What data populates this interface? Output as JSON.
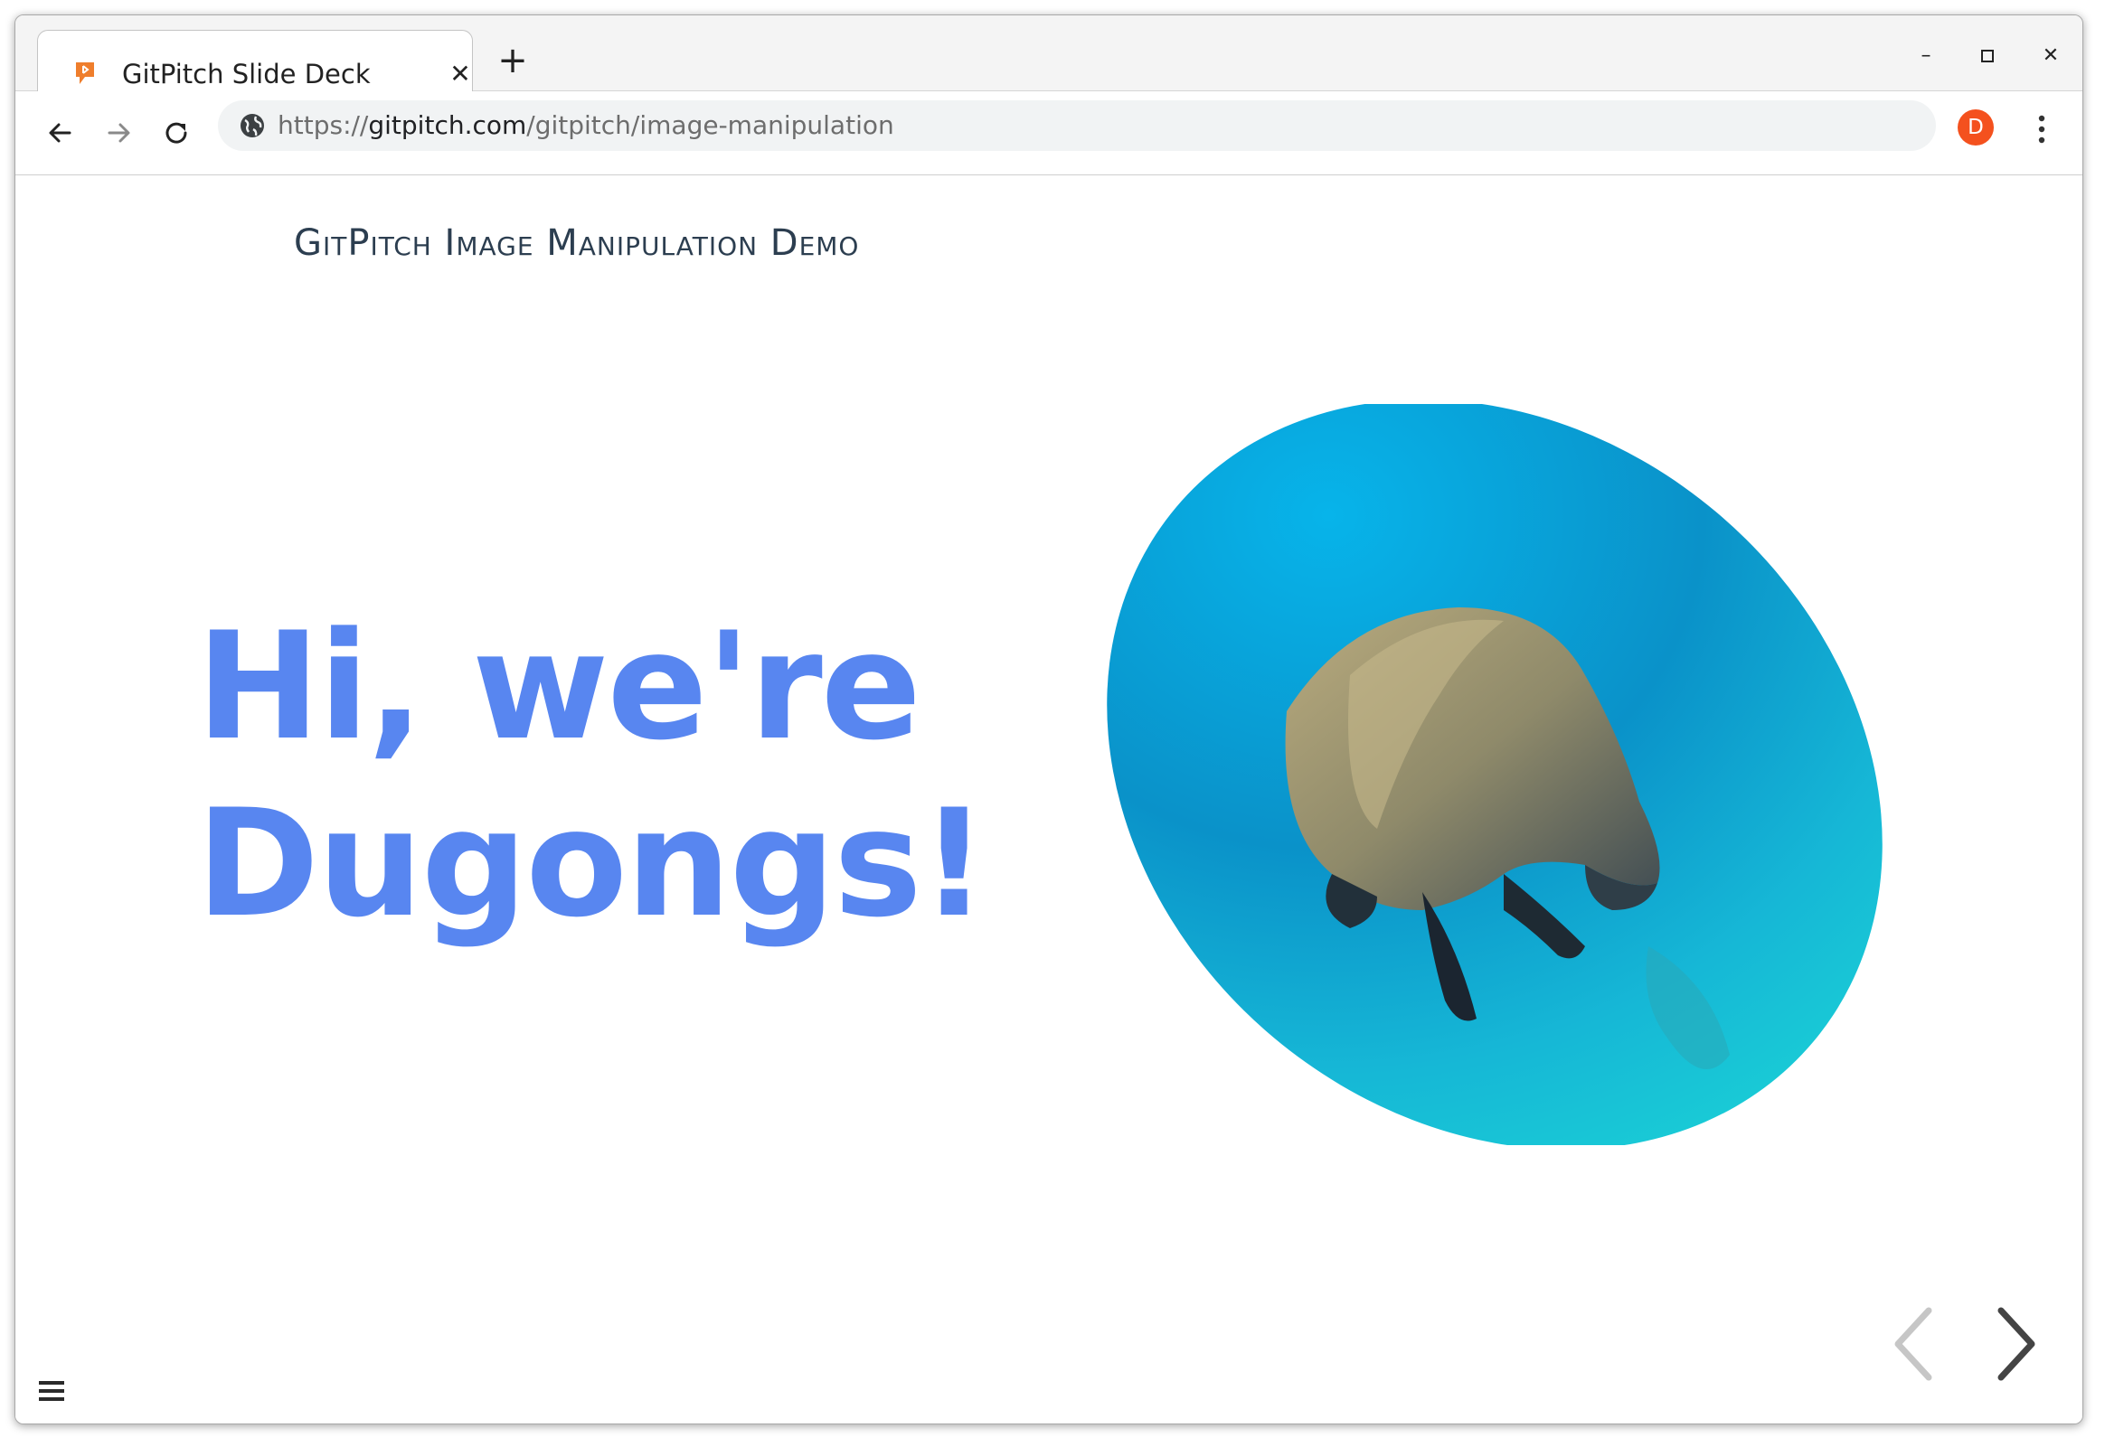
{
  "browser": {
    "tab": {
      "title": "GitPitch Slide Deck",
      "close_glyph": "✕"
    },
    "new_tab_glyph": "+",
    "window_controls": {
      "minimize": "–",
      "maximize": "☐",
      "close": "✕"
    },
    "address": {
      "scheme": "https://",
      "domain": "gitpitch.com",
      "path": "/gitpitch/image-manipulation"
    },
    "profile_initial": "D",
    "profile_color": "#f4511e",
    "icons": [
      "back-arrow-icon",
      "forward-arrow-icon",
      "reload-icon",
      "globe-icon",
      "more-vert-icon"
    ]
  },
  "slide": {
    "title": "GitPitch Image Manipulation Demo",
    "headline_line1": "Hi, we're",
    "headline_line2": "Dugongs!",
    "accent_color": "#5886f0",
    "title_color": "#2c3e50",
    "image": "dugong-photo-in-ellipse"
  },
  "controls": {
    "prev_icon": "chevron-left-icon",
    "next_icon": "chevron-right-icon",
    "menu_icon": "hamburger-menu-icon"
  }
}
